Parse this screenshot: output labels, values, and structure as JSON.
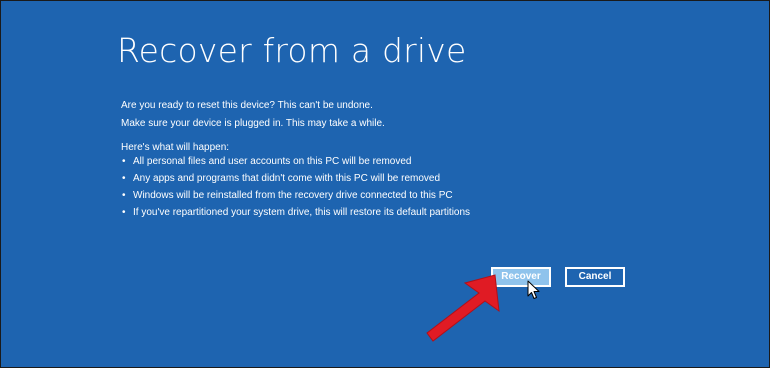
{
  "dialog": {
    "title": "Recover from a drive",
    "intro_lines": [
      "Are you ready to reset this device? This can't be undone.",
      "Make sure your device is plugged in. This may take a while."
    ],
    "list_heading": "Here's what will happen:",
    "bullet_glyph": "•",
    "consequences": [
      "All personal files and user accounts on this PC will be removed",
      "Any apps and programs that didn't come with this PC will be removed",
      "Windows will be reinstalled from the recovery drive connected to this PC",
      "If you've repartitioned your system drive, this will restore its default partitions"
    ],
    "buttons": {
      "recover_label": "Recover",
      "cancel_label": "Cancel"
    }
  },
  "colors": {
    "background": "#1e64b0",
    "recover_button_fill": "#8fc3ec",
    "annotation_arrow": "#e01b24"
  },
  "icons": {
    "pointer": "mouse-pointer-icon",
    "annotation": "red-arrow-annotation"
  }
}
